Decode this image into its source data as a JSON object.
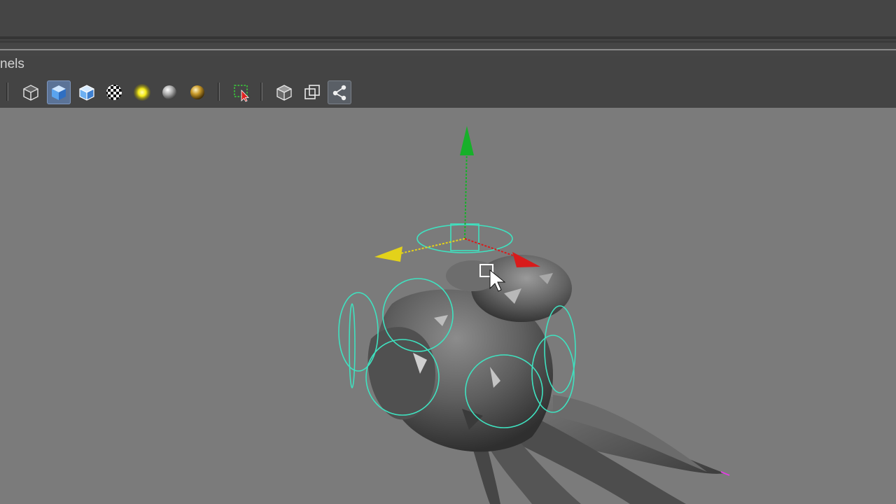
{
  "panel_menu": {
    "label": "nels"
  },
  "toolbar": {
    "buttons": [
      {
        "name": "wireframe-cube-icon"
      },
      {
        "name": "smooth-shade-cube-icon",
        "active": true
      },
      {
        "name": "wireframe-on-shaded-cube-icon"
      },
      {
        "name": "checker-texture-icon"
      },
      {
        "name": "default-light-icon"
      },
      {
        "name": "grey-shaded-sphere-icon"
      },
      {
        "name": "gold-shaded-sphere-icon"
      },
      {
        "name": "select-marquee-icon"
      },
      {
        "name": "isolate-select-cube-icon"
      },
      {
        "name": "xray-overlap-icon"
      },
      {
        "name": "share-nodes-icon"
      }
    ]
  },
  "colors": {
    "viewport_bg": "#7b7b7b",
    "nurbs_curve": "#3fe2c0",
    "axis_y": "#17b02a",
    "axis_x": "#d81b1b",
    "axis_z": "#e3d21a"
  }
}
